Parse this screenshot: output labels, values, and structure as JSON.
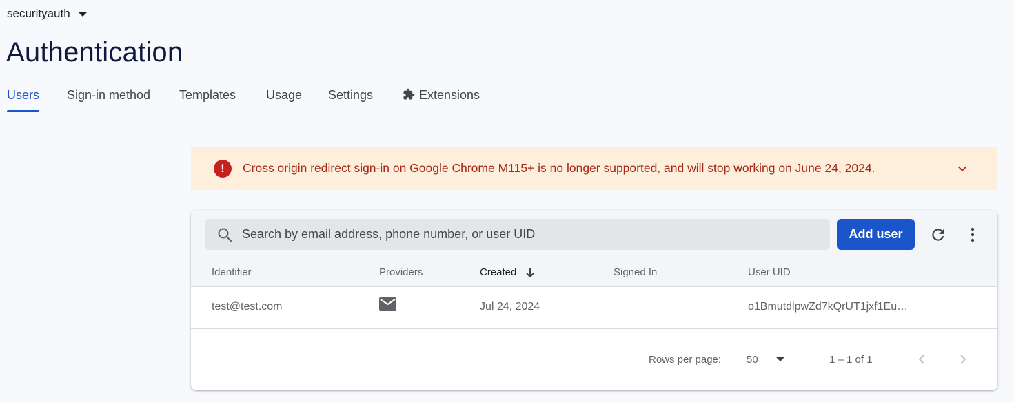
{
  "project": {
    "name": "securityauth"
  },
  "page": {
    "title": "Authentication"
  },
  "tabs": [
    {
      "label": "Users",
      "active": true
    },
    {
      "label": "Sign-in method"
    },
    {
      "label": "Templates"
    },
    {
      "label": "Usage"
    },
    {
      "label": "Settings"
    },
    {
      "label": "Extensions",
      "icon": "puzzle-icon"
    }
  ],
  "banner": {
    "icon": "error-icon",
    "message": "Cross origin redirect sign-in on Google Chrome M115+ is no longer supported, and will stop working on June 24, 2024.",
    "text_color": "#a52714",
    "background": "#fdefdc"
  },
  "users_table": {
    "search": {
      "placeholder": "Search by email address, phone number, or user UID",
      "value": ""
    },
    "add_user_label": "Add user",
    "columns": [
      "Identifier",
      "Providers",
      "Created",
      "Signed In",
      "User UID"
    ],
    "sorted_column": "Created",
    "sort_direction": "descending",
    "rows": [
      {
        "identifier": "test@test.com",
        "provider_icon": "mail-icon",
        "created": "Jul 24, 2024",
        "signed_in": "",
        "uid": "o1BmutdlpwZd7kQrUT1jxf1Eu…"
      }
    ],
    "pagination": {
      "rows_per_page_label": "Rows per page:",
      "rows_per_page": "50",
      "range": "1 – 1 of 1"
    }
  },
  "colors": {
    "accent": "#1a56c9",
    "error": "#c5221f"
  }
}
